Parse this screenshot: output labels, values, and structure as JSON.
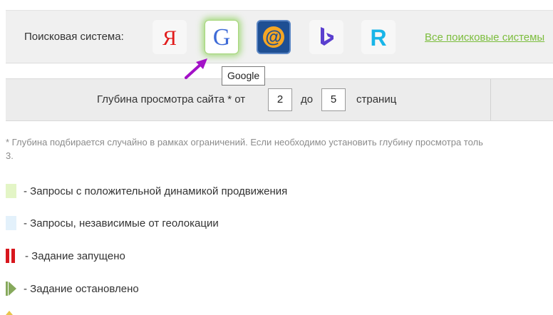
{
  "engine_bar": {
    "label": "Поисковая система:",
    "engines": [
      {
        "id": "yandex",
        "glyph": "Я",
        "selected": false
      },
      {
        "id": "google",
        "glyph": "G",
        "selected": true
      },
      {
        "id": "mail",
        "glyph": "@",
        "selected": false
      },
      {
        "id": "bing",
        "glyph": "b",
        "selected": false
      },
      {
        "id": "rambler",
        "glyph": "R",
        "selected": false
      }
    ],
    "all_engines_link": "Все поисковые системы"
  },
  "tooltip": {
    "text": "Google"
  },
  "depth": {
    "label": "Глубина просмотра сайта * от",
    "from_value": "2",
    "to_label": "до",
    "to_value": "5",
    "unit_label": "страниц"
  },
  "note": {
    "line1": "* Глубина подбирается случайно в рамках ограничений. Если необходимо установить глубину просмотра толь",
    "line2": "3."
  },
  "legend": [
    {
      "text": "- Запросы с положительной динамикой продвижения",
      "icon": "light-green-square",
      "color": "#e3f5c6"
    },
    {
      "text": "- Запросы, независимые от геолокации",
      "icon": "light-blue-square",
      "color": "#e3f1fb"
    },
    {
      "text": "- Задание запущено",
      "icon": "red-pause",
      "color": "#d8161d"
    },
    {
      "text": "- Задание остановлено",
      "icon": "green-play",
      "color": "#86a95c"
    }
  ],
  "colors": {
    "link_green": "#7cbd3d",
    "selection_glow": "#8cd25a",
    "arrow_purple": "#a312c7",
    "yandex_red": "#e11b1b",
    "google_blue": "#3e6bd7",
    "mail_orange": "#f5a623",
    "mail_blue": "#1e4f93",
    "bing_blue": "#5a3fcf",
    "rambler_cyan": "#18b5e8"
  }
}
